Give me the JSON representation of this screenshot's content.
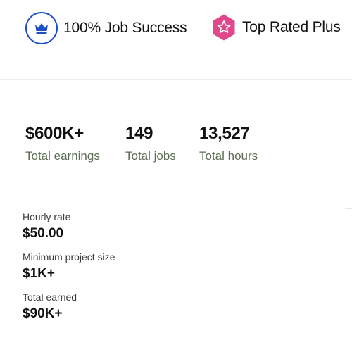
{
  "badges": {
    "job_success": {
      "label": "100% Job Success",
      "icon": "crown-icon",
      "color": "#1d4fc4"
    },
    "top_rated": {
      "label": "Top Rated Plus",
      "icon": "star-icon",
      "color": "#e0488b"
    }
  },
  "stats": [
    {
      "value": "$600K+",
      "label": "Total earnings"
    },
    {
      "value": "149",
      "label": "Total jobs"
    },
    {
      "value": "13,527",
      "label": "Total hours"
    }
  ],
  "details": [
    {
      "label": "Hourly rate",
      "value": "$50.00"
    },
    {
      "label": "Minimum project size",
      "value": "$1K+"
    },
    {
      "label": "Total earned",
      "value": "$90K+"
    }
  ]
}
